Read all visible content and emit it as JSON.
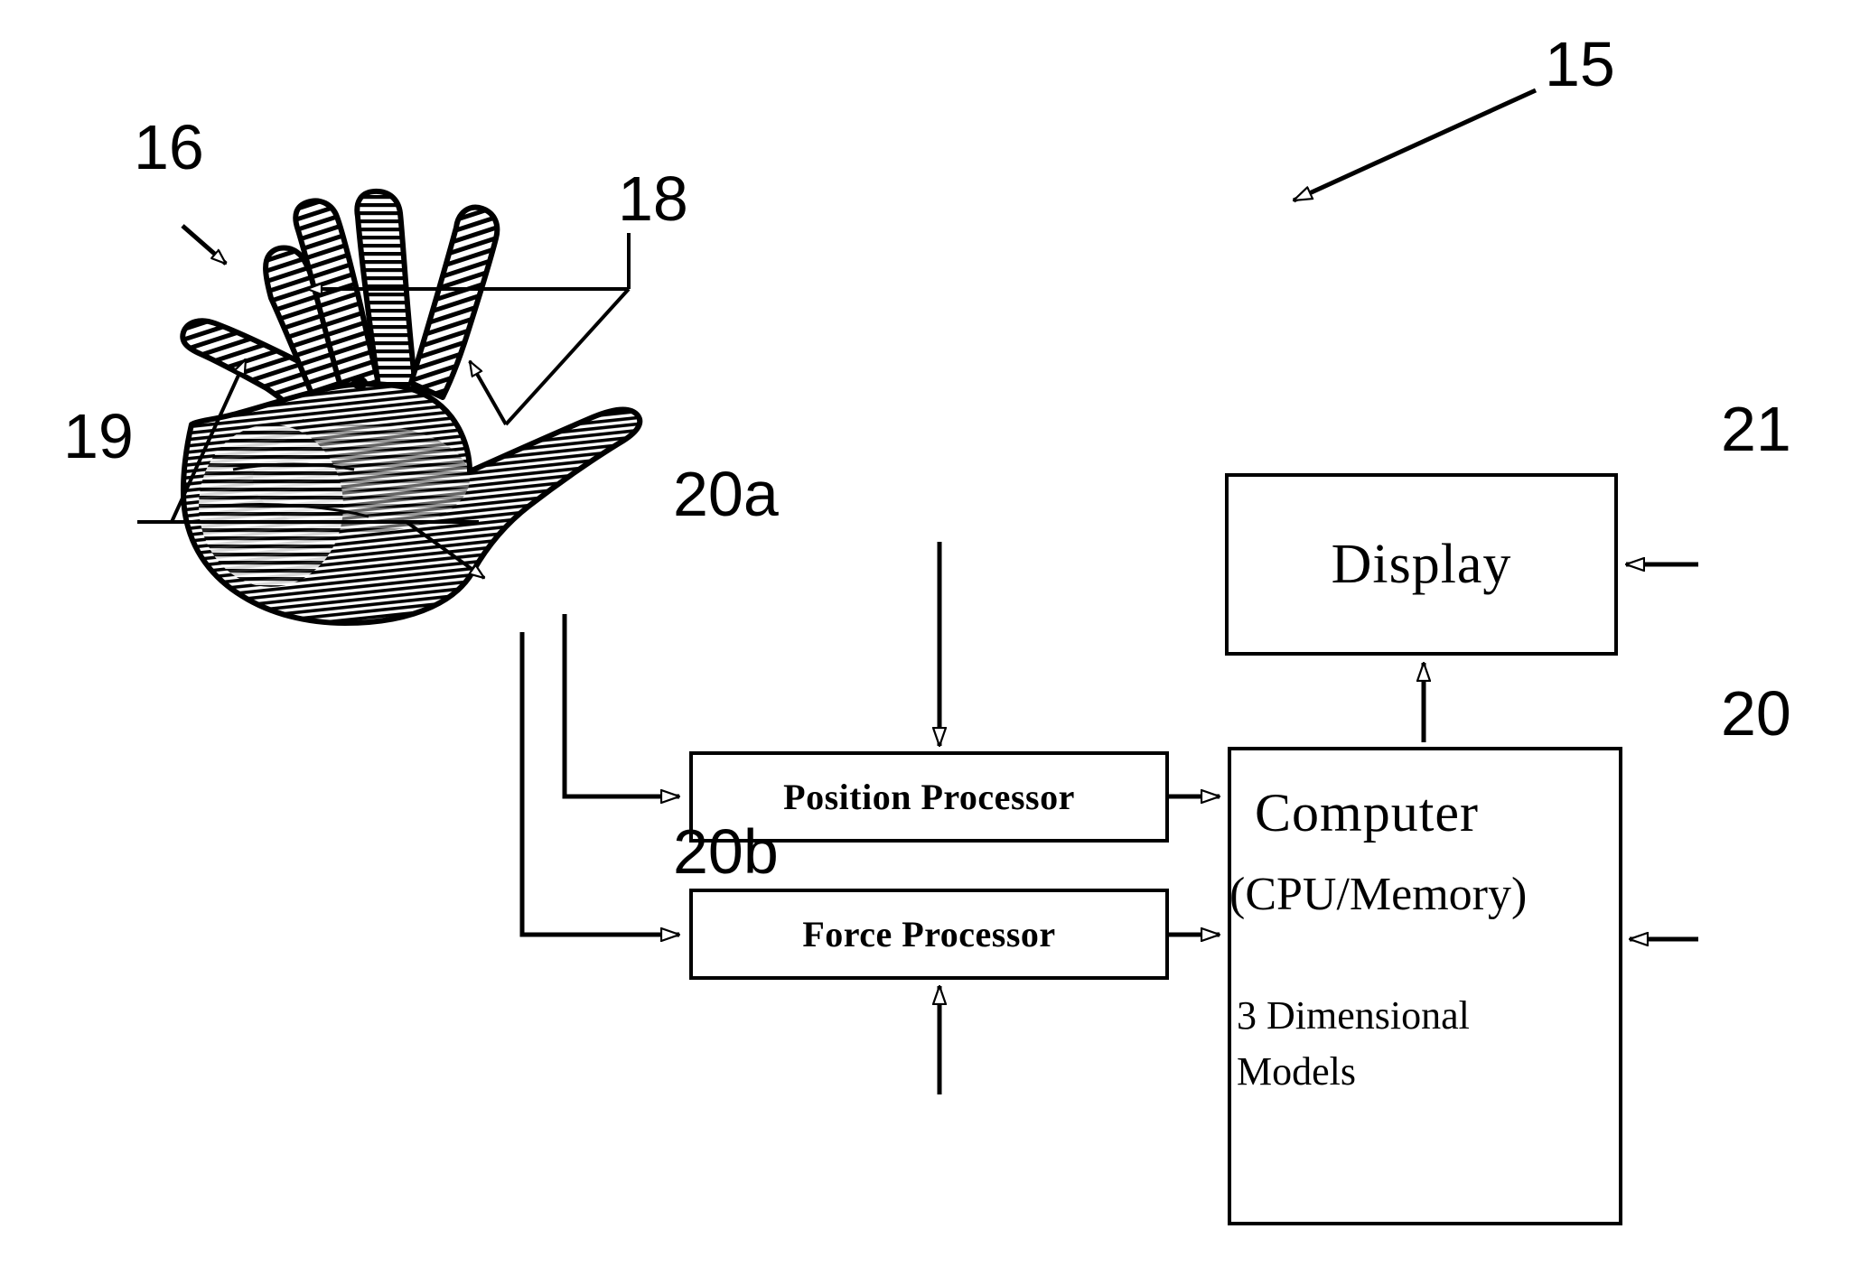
{
  "figure": {
    "type": "patent-block-diagram",
    "background_color": "#ffffff",
    "line_color": "#000000"
  },
  "boxes": {
    "display": {
      "label": "Display",
      "ref": "21"
    },
    "position_processor": {
      "label": "Position Processor",
      "ref": "20a"
    },
    "force_processor": {
      "label": "Force Processor",
      "ref": "20b"
    },
    "computer": {
      "line1": "Computer",
      "line2": "(CPU/Memory)",
      "line3": "3 Dimensional",
      "line4": "Models",
      "ref": "20"
    }
  },
  "reference_numerals": {
    "system": "15",
    "hand": "16",
    "fingertip_sensors": "18",
    "thumb_sensors": "19",
    "position_processor": "20a",
    "force_processor": "20b",
    "computer": "20",
    "display": "21"
  },
  "illustration": {
    "name": "engraved-open-hand",
    "description": "Cross-hatched line-art drawing of an open human hand, palm facing viewer, fingers spread"
  },
  "connections": [
    {
      "from": "hand",
      "to": "position_processor",
      "arrow": "hollow-triangle"
    },
    {
      "from": "hand",
      "to": "force_processor",
      "arrow": "hollow-triangle"
    },
    {
      "from": "position_processor",
      "to": "computer",
      "arrow": "hollow-triangle"
    },
    {
      "from": "force_processor",
      "to": "computer",
      "arrow": "hollow-triangle"
    },
    {
      "from": "computer",
      "to": "display",
      "arrow": "hollow-triangle"
    }
  ]
}
